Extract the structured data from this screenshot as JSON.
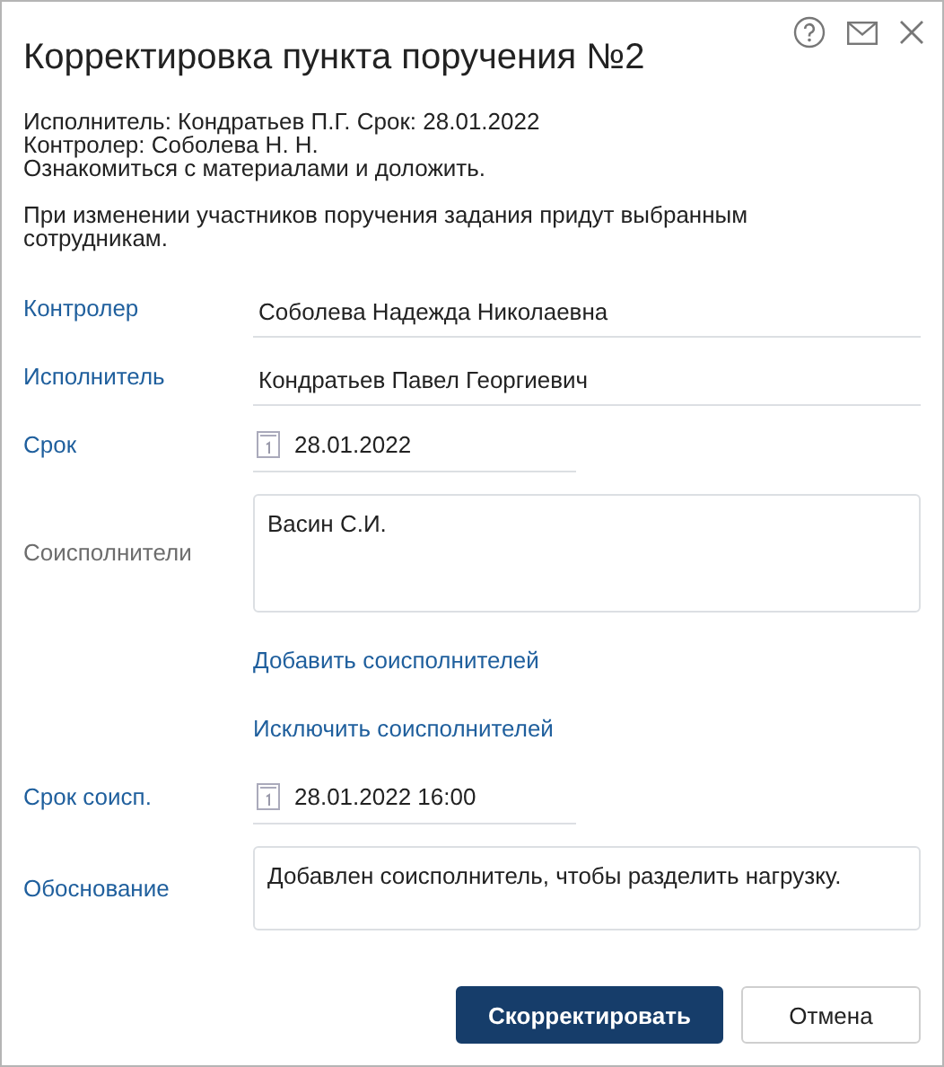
{
  "window": {
    "title": "Корректировка пункта поручения №2"
  },
  "info": [
    "Исполнитель: Кондратьев П.Г. Срок: 28.01.2022",
    "Контролер: Соболева Н. Н.",
    "Ознакомиться с материалами и доложить."
  ],
  "notice": "При изменении участников поручения задания придут выбранным сотрудникам.",
  "fields": [
    {
      "kind": "text",
      "label": "Контролер",
      "muted": false,
      "value": "Соболева Надежда Николаевна"
    },
    {
      "kind": "text",
      "label": "Исполнитель",
      "muted": false,
      "value": "Кондратьев Павел Георгиевич"
    },
    {
      "kind": "date",
      "label": "Срок",
      "muted": false,
      "value": "28.01.2022"
    },
    {
      "kind": "area",
      "label": "Соисполнители",
      "muted": true,
      "value": "Васин С.И.",
      "tall": true
    },
    {
      "kind": "link",
      "text": "Добавить соисполнителей"
    },
    {
      "kind": "link",
      "text": "Исключить соисполнителей"
    },
    {
      "kind": "date",
      "label": "Срок соисп.",
      "muted": false,
      "value": "28.01.2022 16:00"
    },
    {
      "kind": "area",
      "label": "Обоснование",
      "muted": false,
      "value": "Добавлен соисполнитель, чтобы разделить нагрузку.",
      "tall": false
    }
  ],
  "buttons": [
    {
      "label": "Скорректировать",
      "primary": true
    },
    {
      "label": "Отмена",
      "primary": false
    }
  ]
}
